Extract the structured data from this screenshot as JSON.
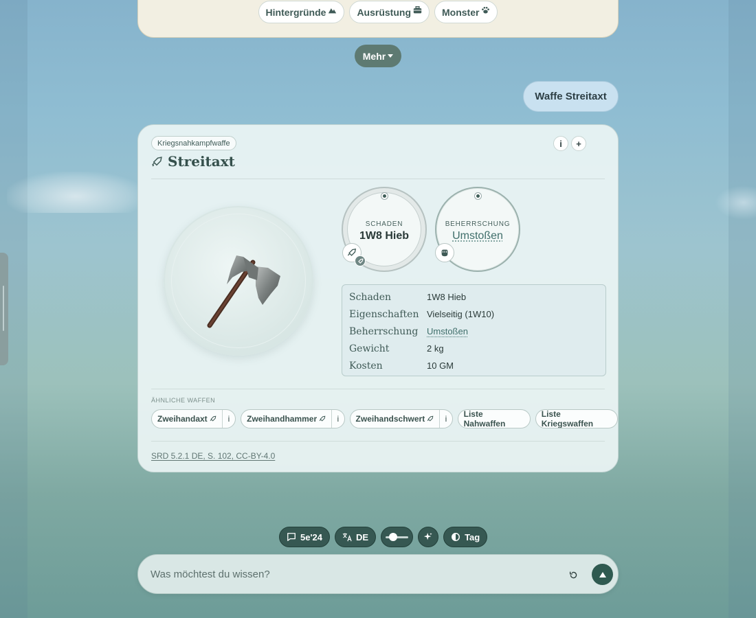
{
  "colors": {
    "accent": "#365852",
    "card_bg": "#ebf4f4",
    "user_bubble": "#c9e1f0",
    "top_card_bg": "#f2efe2"
  },
  "top_chips": [
    {
      "label": "Hintergründe",
      "icon": "mountain-icon"
    },
    {
      "label": "Ausrüstung",
      "icon": "toolbox-icon"
    },
    {
      "label": "Monster",
      "icon": "paw-icon"
    }
  ],
  "more_button": {
    "label": "Mehr",
    "icon": "caret-down-icon"
  },
  "user_message": "Waffe Streitaxt",
  "card": {
    "tag": "Kriegsnahkampfwaffe",
    "info_label": "i",
    "add_label": "+",
    "title": "Streitaxt",
    "title_icon": "sword-icon",
    "image_icon": "battleaxe-icon",
    "stat_damage": {
      "label": "SCHADEN",
      "value": "1W8 Hieb"
    },
    "stat_mastery": {
      "label": "BEHERRSCHUNG",
      "value": "Umstoßen"
    },
    "properties": [
      {
        "key": "Schaden",
        "value": "1W8 Hieb"
      },
      {
        "key": "Eigenschaften",
        "value": "Vielseitig (1W10)"
      },
      {
        "key": "Beherrschung",
        "value": "Umstoßen"
      },
      {
        "key": "Gewicht",
        "value": "2 kg"
      },
      {
        "key": "Kosten",
        "value": "10 GM"
      }
    ],
    "similar_label": "ÄHNLICHE WAFFEN",
    "similar": [
      {
        "label": "Zweihandaxt",
        "info": "i"
      },
      {
        "label": "Zweihandhammer",
        "info": "i"
      },
      {
        "label": "Zweihandschwert",
        "info": "i"
      }
    ],
    "lists": [
      "Liste Nahwaffen",
      "Liste Kriegswaffen"
    ],
    "source": "SRD 5.2.1 DE, S. 102, CC-BY-4.0"
  },
  "toolbar": {
    "edition": "5e'24",
    "language": "DE",
    "theme": "Tag"
  },
  "input": {
    "placeholder": "Was möchtest du wissen?"
  }
}
